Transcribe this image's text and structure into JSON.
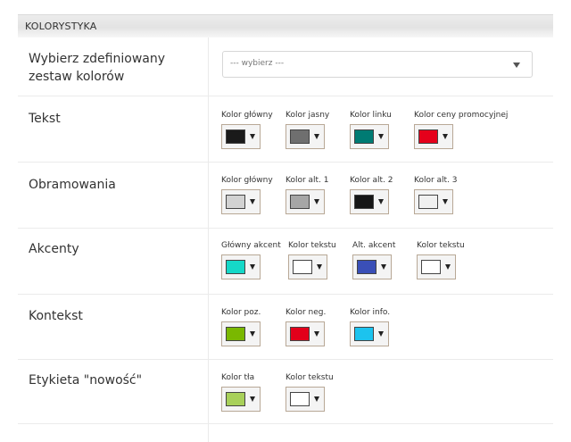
{
  "section_title": "KOLORYSTYKA",
  "rows": [
    {
      "label": "Wybierz zdefiniowany zestaw kolorów",
      "select_value": "--- wybierz ---"
    },
    {
      "label": "Tekst",
      "pickers": [
        {
          "label": "Kolor główny",
          "color": "#1a1a1a"
        },
        {
          "label": "Kolor jasny",
          "color": "#6f6f6f"
        },
        {
          "label": "Kolor linku",
          "color": "#007b73"
        },
        {
          "label": "Kolor ceny promocyjnej",
          "color": "#e5001b"
        }
      ]
    },
    {
      "label": "Obramowania",
      "pickers": [
        {
          "label": "Kolor główny",
          "color": "#d2d2d2"
        },
        {
          "label": "Kolor alt. 1",
          "color": "#a6a6a6"
        },
        {
          "label": "Kolor alt. 2",
          "color": "#161616"
        },
        {
          "label": "Kolor alt. 3",
          "color": "#f0f0f0"
        }
      ]
    },
    {
      "label": "Akcenty",
      "pickers": [
        {
          "label": "Główny akcent",
          "color": "#15d8c8"
        },
        {
          "label": "Kolor tekstu",
          "color": "#ffffff"
        },
        {
          "label": "Alt. akcent",
          "color": "#3a4fb7"
        },
        {
          "label": "Kolor tekstu",
          "color": "#ffffff"
        }
      ]
    },
    {
      "label": "Kontekst",
      "pickers": [
        {
          "label": "Kolor poz.",
          "color": "#7ab800"
        },
        {
          "label": "Kolor neg.",
          "color": "#e2001a"
        },
        {
          "label": "Kolor info.",
          "color": "#1cc3ee"
        }
      ]
    },
    {
      "label": "Etykieta \"nowość\"",
      "pickers": [
        {
          "label": "Kolor tła",
          "color": "#a8d05a"
        },
        {
          "label": "Kolor tekstu",
          "color": "#ffffff"
        }
      ]
    }
  ]
}
